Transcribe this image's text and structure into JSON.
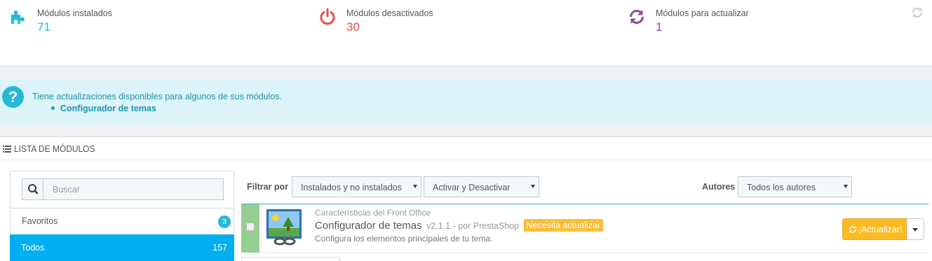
{
  "kpis": [
    {
      "label": "Módulos instalados",
      "value": "71",
      "icon": "puzzle-icon",
      "color": "#25b9d7"
    },
    {
      "label": "Módulos desactivados",
      "value": "30",
      "icon": "power-icon",
      "color": "#e84e4e"
    },
    {
      "label": "Módulos para actualizar",
      "value": "1",
      "icon": "refresh-icon",
      "color": "#8a4f8f"
    }
  ],
  "alert": {
    "message": "Tiene actualizaciones disponibles para algunos de sus módulos.",
    "item": "Configurador de temas"
  },
  "panel": {
    "title": "LISTA DE MÓDULOS"
  },
  "sidebar": {
    "search_placeholder": "Buscar",
    "categories": [
      {
        "label": "Favoritos",
        "count": "3"
      },
      {
        "label": "Todos",
        "count": "157"
      }
    ]
  },
  "filters": {
    "filter_label": "Filtrar por",
    "install_select": "Instalados y no instalados",
    "status_select": "Activar y Desactivar",
    "authors_label": "Autores",
    "authors_select": "Todos los autores"
  },
  "module": {
    "category": "Características del Front Office",
    "name": "Configurador de temas",
    "version_author": "v2.1.1 - por PrestaShop",
    "badge": "Necesita actualizar",
    "description": "Configura los elementos principales de tu tema.",
    "action": "¡Actualizar!"
  },
  "colors": {
    "accent": "#25b9d7",
    "alert_bg": "#dcf4f9",
    "selected": "#00aff0",
    "warning": "#fbbb22"
  }
}
